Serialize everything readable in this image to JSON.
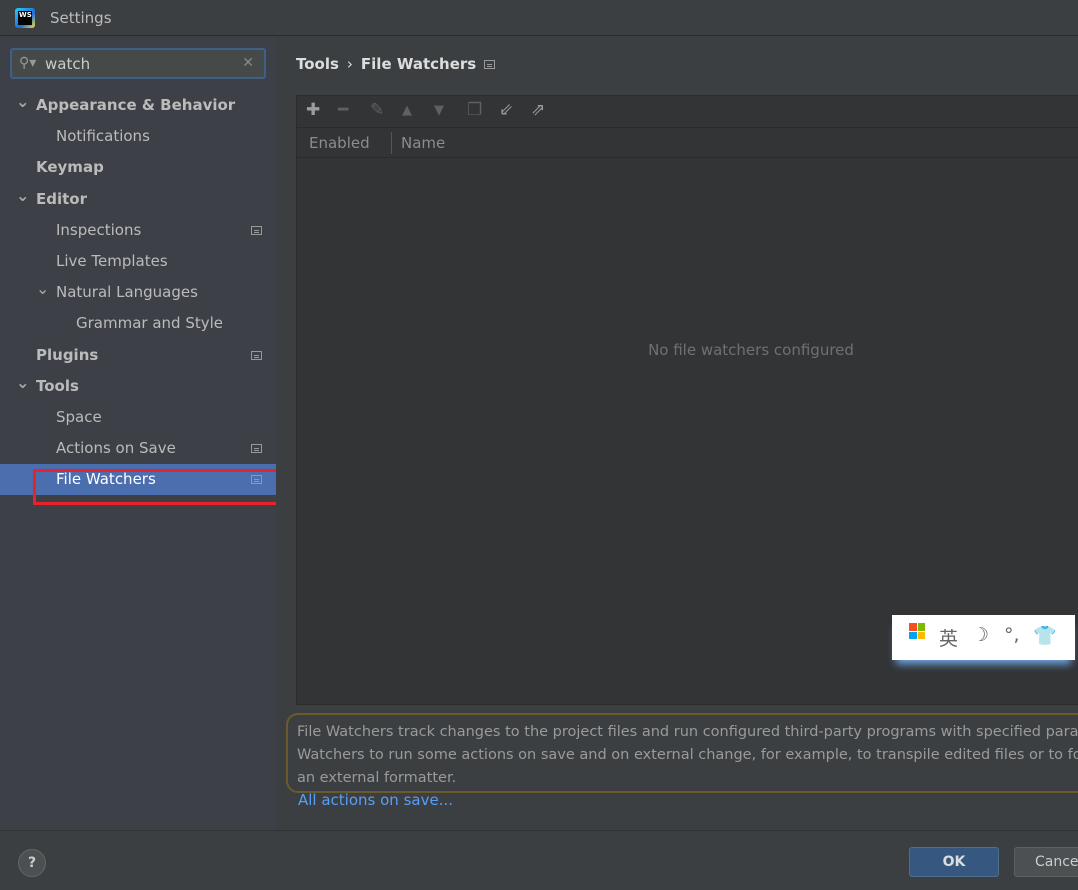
{
  "window": {
    "title": "Settings",
    "app_icon": "webstorm-logo",
    "app_icon_text": "WS"
  },
  "search": {
    "value": "watch",
    "icon": "search-icon",
    "clear_icon": "close-icon"
  },
  "sidebar": {
    "items": [
      {
        "label": "Appearance & Behavior",
        "expanded": true
      },
      {
        "label": "Notifications"
      },
      {
        "label": "Keymap"
      },
      {
        "label": "Editor",
        "expanded": true
      },
      {
        "label": "Inspections",
        "project_scope": true
      },
      {
        "label": "Live Templates"
      },
      {
        "label": "Natural Languages",
        "expanded": true
      },
      {
        "label": "Grammar and Style"
      },
      {
        "label": "Plugins",
        "project_scope": true
      },
      {
        "label": "Tools",
        "expanded": true
      },
      {
        "label": "Space"
      },
      {
        "label": "Actions on Save",
        "project_scope": true
      },
      {
        "label": "File Watchers",
        "project_scope": true,
        "selected": true
      }
    ]
  },
  "main": {
    "breadcrumb": [
      "Tools",
      "File Watchers"
    ],
    "toolbar": [
      "add-icon",
      "remove-icon",
      "edit-icon",
      "move-up-icon",
      "move-down-icon",
      "copy-icon",
      "import-icon",
      "export-icon"
    ],
    "columns": [
      "Enabled",
      "Name"
    ],
    "empty_text": "No file watchers configured",
    "description_lines": [
      "File Watchers track changes to the project files and run configured third-party programs with specified para",
      "Watchers to run some actions on save and on external change, for example, to transpile edited files or to for",
      "an external formatter."
    ],
    "link": "All actions on save..."
  },
  "footer": {
    "help": "?",
    "ok": "OK",
    "cancel": "Cance"
  },
  "ime": {
    "lang": "英",
    "items": [
      "windows-logo-icon",
      "moon-icon",
      "punctuation-icon",
      "shirt-icon"
    ],
    "punct": "°,"
  },
  "colors": {
    "selection": "#4b6eaf",
    "accent_link": "#589df6",
    "highlight": "#e8212b",
    "ok_button": "#365880"
  }
}
